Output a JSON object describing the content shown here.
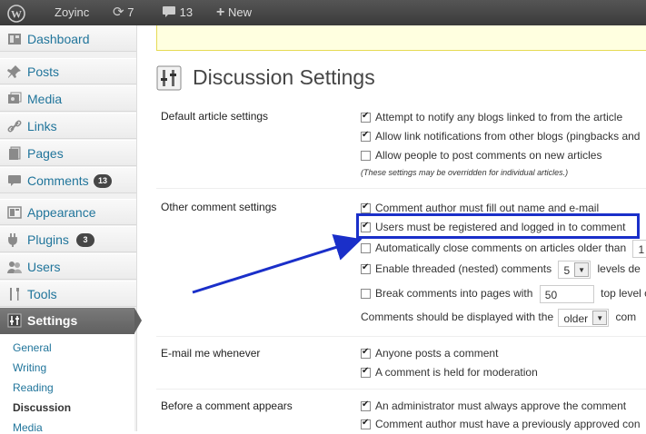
{
  "adminbar": {
    "site_name": "Zoyinc",
    "updates_count": "7",
    "comments_count": "13",
    "new_label": "New"
  },
  "sidebar": {
    "items": [
      {
        "label": "Dashboard",
        "icon": "dashboard-icon"
      },
      {
        "label": "Posts",
        "icon": "pin-icon"
      },
      {
        "label": "Media",
        "icon": "media-icon"
      },
      {
        "label": "Links",
        "icon": "link-icon"
      },
      {
        "label": "Pages",
        "icon": "pages-icon"
      },
      {
        "label": "Comments",
        "icon": "comment-icon",
        "badge": "13"
      },
      {
        "label": "Appearance",
        "icon": "appearance-icon"
      },
      {
        "label": "Plugins",
        "icon": "plugin-icon",
        "badge": "3"
      },
      {
        "label": "Users",
        "icon": "users-icon"
      },
      {
        "label": "Tools",
        "icon": "tools-icon"
      },
      {
        "label": "Settings",
        "icon": "settings-icon"
      }
    ],
    "submenu": [
      "General",
      "Writing",
      "Reading",
      "Discussion",
      "Media"
    ]
  },
  "page": {
    "title": "Discussion Settings"
  },
  "sections": {
    "default_article": {
      "label": "Default article settings",
      "options": [
        "Attempt to notify any blogs linked to from the article",
        "Allow link notifications from other blogs (pingbacks and",
        "Allow people to post comments on new articles"
      ],
      "note": "(These settings may be overridden for individual articles.)"
    },
    "other_comment": {
      "label": "Other comment settings",
      "options": [
        "Comment author must fill out name and e-mail",
        "Users must be registered and logged in to comment",
        "Automatically close comments on articles older than"
      ],
      "close_days_value": "1",
      "threaded_label": "Enable threaded (nested) comments",
      "threaded_depth": "5",
      "threaded_suffix": "levels de",
      "break_label": "Break comments into pages with",
      "break_value": "50",
      "break_suffix": "top level c",
      "display_label": "Comments should be displayed with the",
      "display_value": "older",
      "display_suffix": "com"
    },
    "email_me": {
      "label": "E-mail me whenever",
      "options": [
        "Anyone posts a comment",
        "A comment is held for moderation"
      ]
    },
    "before_comment": {
      "label": "Before a comment appears",
      "options": [
        "An administrator must always approve the comment",
        "Comment author must have a previously approved con"
      ]
    }
  },
  "colors": {
    "highlight": "#1a2fc9",
    "link": "#21759b"
  }
}
